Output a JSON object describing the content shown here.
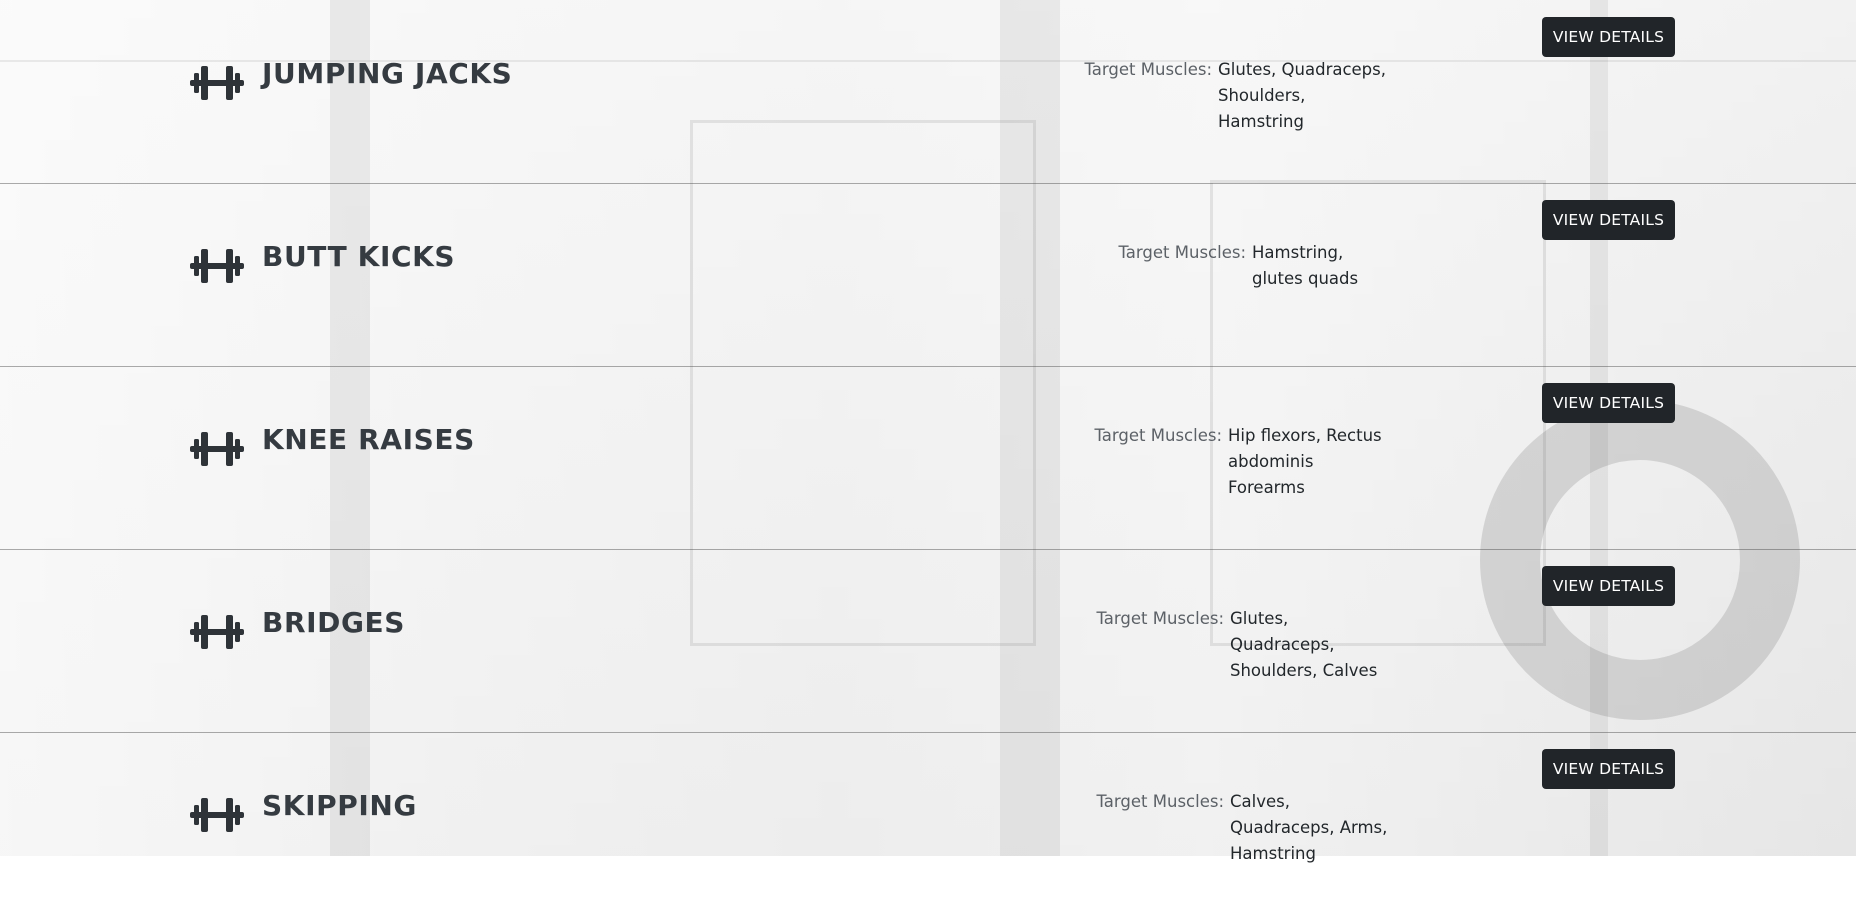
{
  "exercises": [
    {
      "title": "JUMPING JACKS",
      "muscles_label": "Target Muscles:",
      "muscles": "Glutes, Quadraceps, Shoulders, Hamstring",
      "button_label": "VIEW DETAILS",
      "icon": "dumbbell-icon"
    },
    {
      "title": "BUTT KICKS",
      "muscles_label": "Target Muscles:",
      "muscles": "Hamstring, glutes quads",
      "button_label": "VIEW DETAILS",
      "icon": "dumbbell-icon"
    },
    {
      "title": "KNEE RAISES",
      "muscles_label": "Target Muscles:",
      "muscles": "Hip flexors, Rectus abdominis Forearms",
      "button_label": "VIEW DETAILS",
      "icon": "dumbbell-icon"
    },
    {
      "title": "BRIDGES",
      "muscles_label": "Target Muscles:",
      "muscles": "Glutes, Quadraceps, Shoulders, Calves",
      "button_label": "VIEW DETAILS",
      "icon": "dumbbell-icon"
    },
    {
      "title": "SKIPPING",
      "muscles_label": "Target Muscles:",
      "muscles": "Calves, Quadraceps, Arms, Hamstring",
      "button_label": "VIEW DETAILS",
      "icon": "dumbbell-icon"
    }
  ],
  "colors": {
    "button_bg": "#212529",
    "button_text": "#ffffff",
    "title_text": "#353b41",
    "divider": "#6e6e6e"
  }
}
